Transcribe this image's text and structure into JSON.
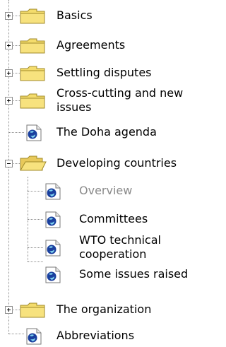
{
  "tree": {
    "items": [
      {
        "label": "Basics",
        "kind": "folder",
        "state": "collapsed",
        "level": 0
      },
      {
        "label": "Agreements",
        "kind": "folder",
        "state": "collapsed",
        "level": 0
      },
      {
        "label": "Settling disputes",
        "kind": "folder",
        "state": "collapsed",
        "level": 0
      },
      {
        "label": "Cross-cutting and new",
        "label2": "issues",
        "kind": "folder",
        "state": "collapsed",
        "level": 0
      },
      {
        "label": "The Doha agenda",
        "kind": "document",
        "level": 0
      },
      {
        "label": "Developing countries",
        "kind": "folder",
        "state": "expanded",
        "level": 0
      },
      {
        "label": "Overview",
        "kind": "document",
        "level": 1,
        "current": true
      },
      {
        "label": "Committees",
        "kind": "document",
        "level": 1
      },
      {
        "label": "WTO technical",
        "label2": "cooperation",
        "kind": "document",
        "level": 1
      },
      {
        "label": "Some issues raised",
        "kind": "document",
        "level": 1
      },
      {
        "label": "The organization",
        "kind": "folder",
        "state": "collapsed",
        "level": 0
      },
      {
        "label": "Abbreviations",
        "kind": "document",
        "level": 0
      }
    ]
  },
  "colors": {
    "folder_fill": "#f4dc6c",
    "folder_edge": "#a08a2a",
    "doc_blue": "#1a3f9e",
    "connector": "#8e8e8e",
    "current_text": "#8a8a8a"
  }
}
